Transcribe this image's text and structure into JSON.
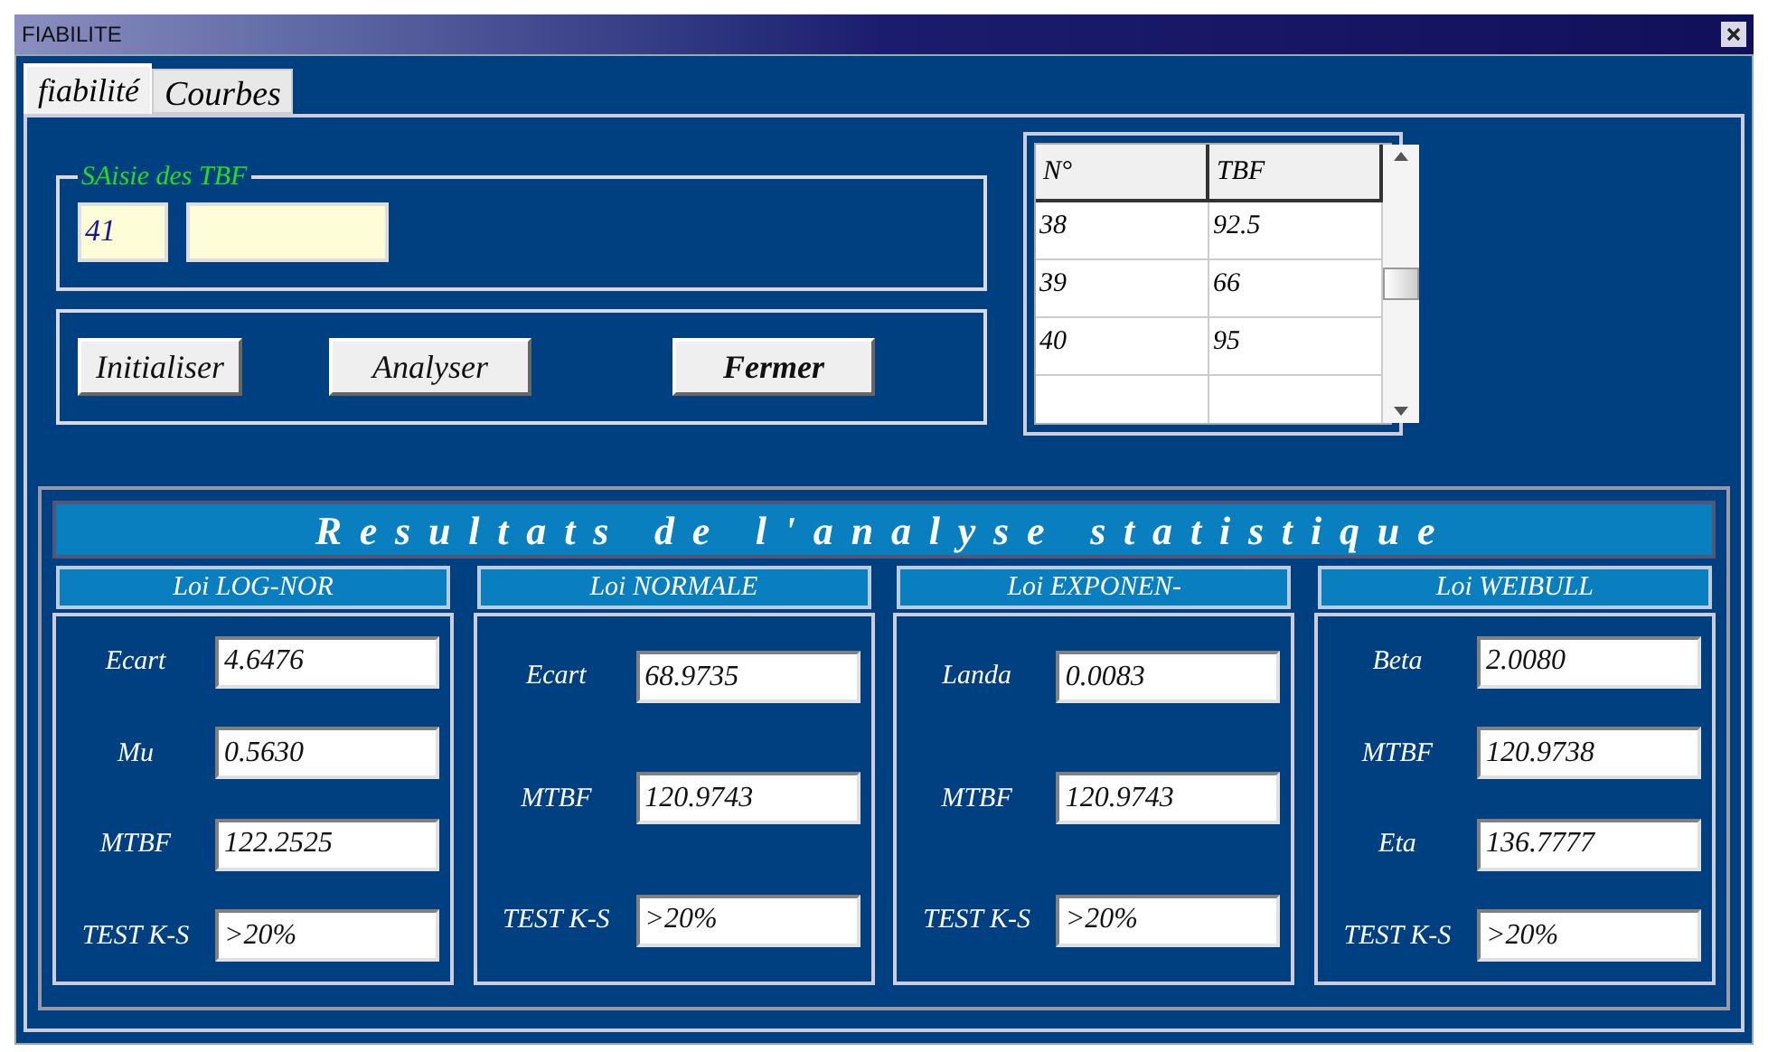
{
  "window": {
    "title": "FIABILITE"
  },
  "tabs": [
    {
      "label": "fiabilité",
      "selected": true
    },
    {
      "label": "Courbes",
      "selected": false
    }
  ],
  "entry": {
    "legend": "SAisie des  TBF",
    "number_value": "41"
  },
  "buttons": [
    {
      "label": "Initialiser",
      "bold": false
    },
    {
      "label": "Analyser",
      "bold": false
    },
    {
      "label": "Fermer",
      "bold": true
    }
  ],
  "table": {
    "columns": [
      "N°",
      "TBF"
    ],
    "rows": [
      [
        "38",
        "92.5"
      ],
      [
        "39",
        "66"
      ],
      [
        "40",
        "95"
      ]
    ]
  },
  "results": {
    "title": "Resultats de l'analyse statistique",
    "laws": [
      {
        "title": "Loi LOG-NOR",
        "rows": [
          {
            "label": "Ecart",
            "value": "4.6476"
          },
          {
            "label": "Mu",
            "value": "0.5630"
          },
          {
            "label": "MTBF",
            "value": "122.2525"
          },
          {
            "label": "TEST K-S",
            "value": ">20%"
          }
        ]
      },
      {
        "title": "Loi NORMALE",
        "rows": [
          {
            "label": "Ecart",
            "value": "68.9735"
          },
          {
            "label": "MTBF",
            "value": "120.9743"
          },
          {
            "label": "TEST K-S",
            "value": ">20%"
          }
        ]
      },
      {
        "title": "Loi EXPONEN-",
        "rows": [
          {
            "label": "Landa",
            "value": "0.0083"
          },
          {
            "label": "MTBF",
            "value": "120.9743"
          },
          {
            "label": "TEST K-S",
            "value": ">20%"
          }
        ]
      },
      {
        "title": "Loi WEIBULL",
        "rows": [
          {
            "label": "Beta",
            "value": "2.0080"
          },
          {
            "label": "MTBF",
            "value": "120.9738"
          },
          {
            "label": "Eta",
            "value": "136.7777"
          },
          {
            "label": "TEST K-S",
            "value": ">20%"
          }
        ]
      }
    ]
  }
}
